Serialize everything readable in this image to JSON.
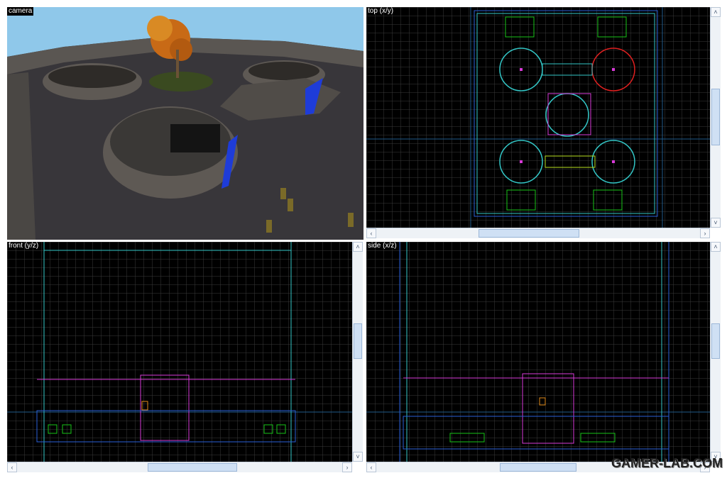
{
  "viewports": {
    "camera": {
      "label": "camera"
    },
    "top": {
      "label": "top (x/y)"
    },
    "front": {
      "label": "front (y/z)"
    },
    "side": {
      "label": "side (x/z)"
    }
  },
  "scrollbars": {
    "up": "˄",
    "down": "˅",
    "left": "‹",
    "right": "›"
  },
  "watermark": "GAMER-LAB.COM",
  "colors": {
    "grid": "#3a3a3a",
    "grid_major": "#1c4a6e",
    "brush_blue": "#2a5fd8",
    "brush_cyan": "#33c6c6",
    "entity_magenta": "#d93ad9",
    "entity_green": "#19c419",
    "selected_red": "#e02020",
    "entity_orange": "#e08a1a"
  }
}
